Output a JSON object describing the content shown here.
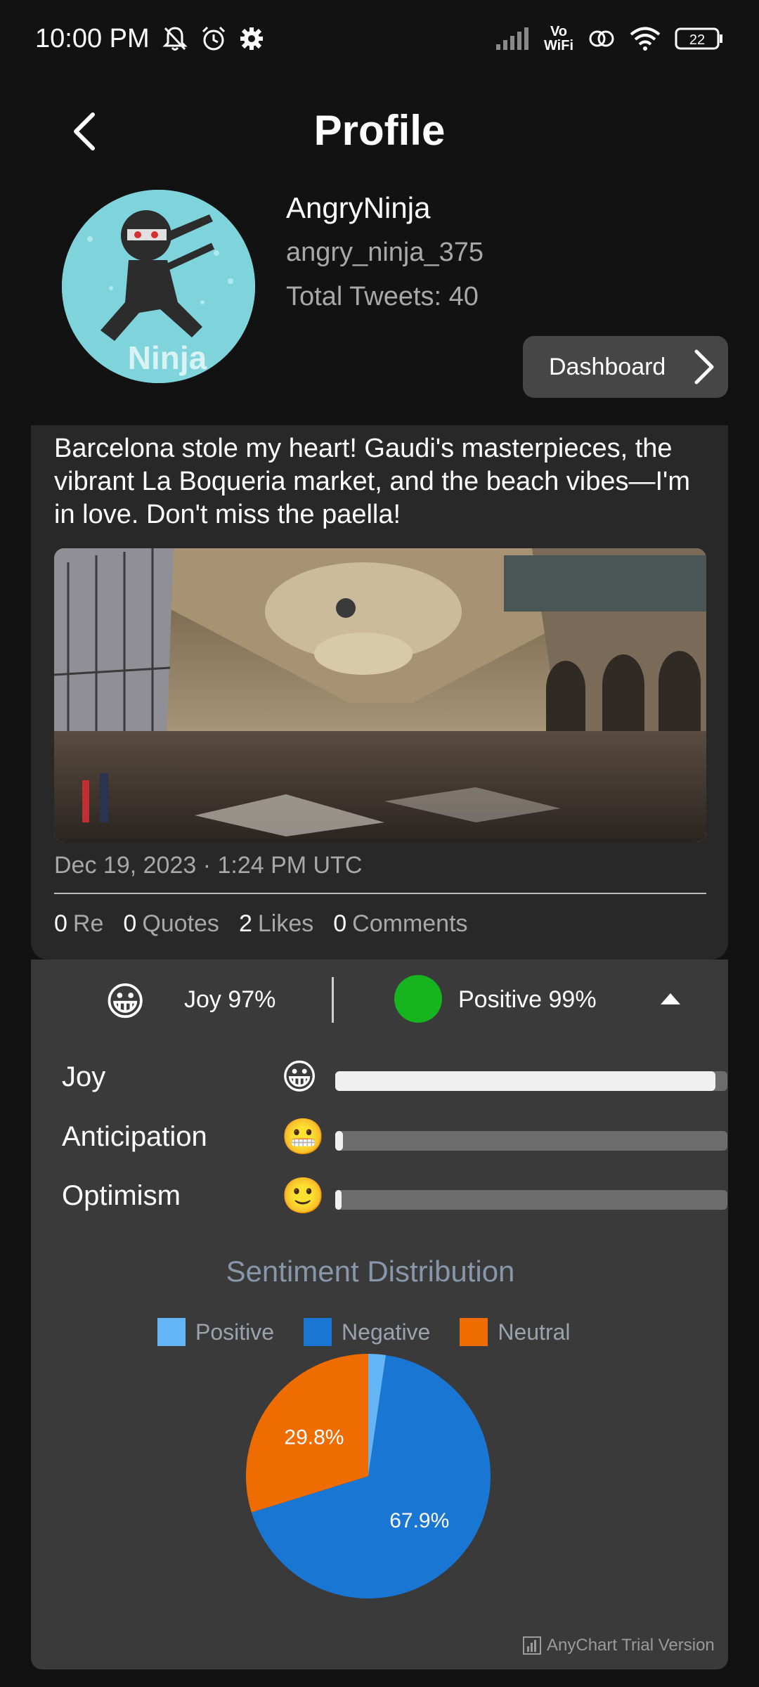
{
  "status_bar": {
    "time": "10:00 PM",
    "battery": "22",
    "icons": [
      "mute-bell-icon",
      "alarm-icon",
      "gear-icon",
      "signal-icon",
      "vowifi-icon",
      "hotspot-icon",
      "wifi-icon",
      "battery-icon"
    ],
    "vowifi_top": "Vo",
    "vowifi_bottom": "WiFi"
  },
  "header": {
    "title": "Profile",
    "back_icon": "chevron-left-icon"
  },
  "profile": {
    "display_name": "AngryNinja",
    "handle": "angry_ninja_375",
    "total_tweets": "Total Tweets: 40",
    "avatar_text": "Ninja",
    "dashboard_label": "Dashboard"
  },
  "tweet": {
    "text": "Barcelona stole my heart! Gaudi's masterpieces, the vibrant La Boqueria market, and the beach vibes—I'm in love. Don't miss the paella!",
    "date": "Dec 19, 2023 · 1:24 PM UTC",
    "stats": [
      {
        "num": "0",
        "label": "Re"
      },
      {
        "num": "0",
        "label": "Quotes"
      },
      {
        "num": "2",
        "label": "Likes"
      },
      {
        "num": "0",
        "label": "Comments"
      }
    ]
  },
  "analysis": {
    "summary_emoji": "😀",
    "summary_emotion": "Joy 97%",
    "summary_sentiment": "Positive 99%",
    "sentiment_color": "#16b41e",
    "emotions": [
      {
        "label": "Joy",
        "emoji": "😀",
        "value": 0.97
      },
      {
        "label": "Anticipation",
        "emoji": "😬",
        "value": 0.02
      },
      {
        "label": "Optimism",
        "emoji": "🙂",
        "value": 0.01
      }
    ]
  },
  "chart_data": {
    "type": "pie",
    "title": "Sentiment Distribution",
    "categories": [
      "Positive",
      "Negative",
      "Neutral"
    ],
    "values": [
      2.3,
      67.9,
      29.8
    ],
    "colors": [
      "#64b5f6",
      "#1976d2",
      "#ef6c00"
    ],
    "data_labels": [
      "",
      "67.9%",
      "29.8%"
    ],
    "legend_position": "top",
    "watermark": "AnyChart Trial Version"
  }
}
